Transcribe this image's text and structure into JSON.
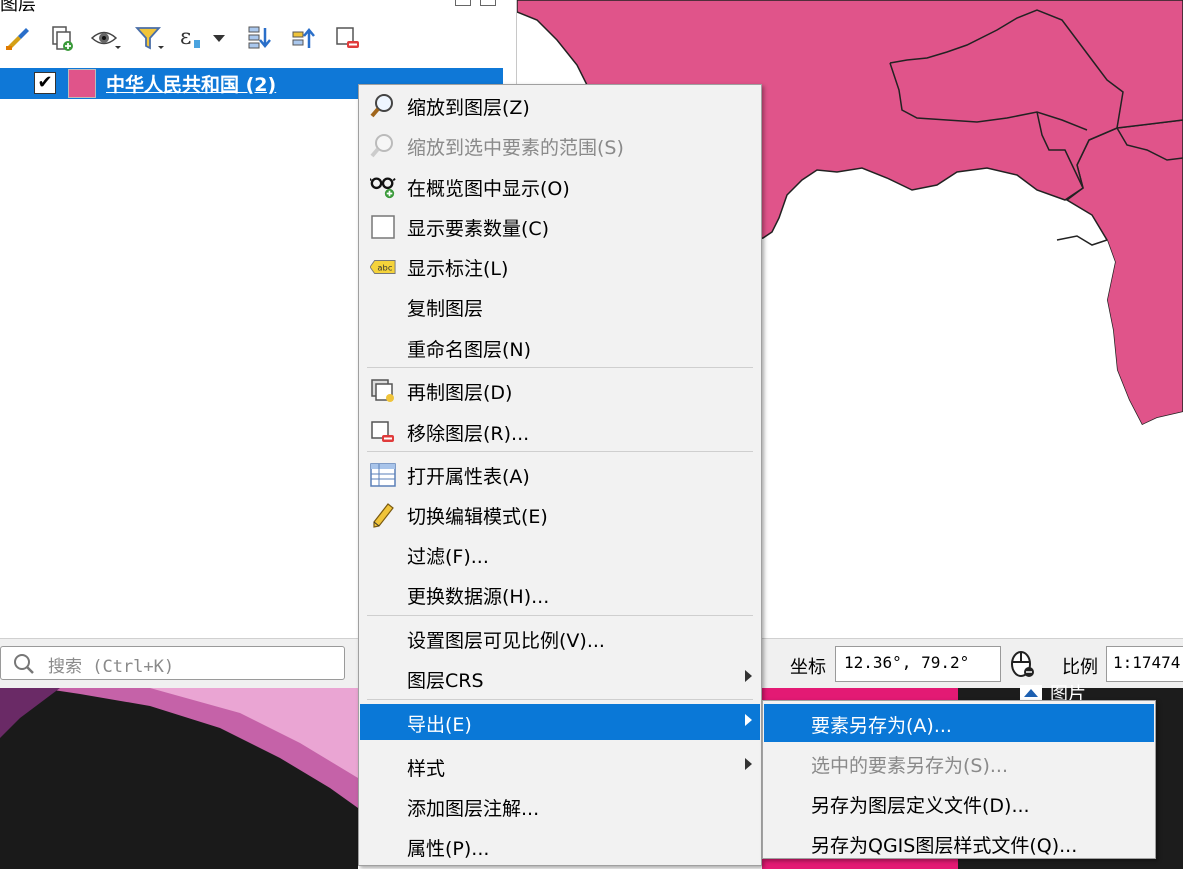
{
  "panel": {
    "title": "图层",
    "layer": {
      "checked": true,
      "check_mark": "✔",
      "name": "中华人民共和国 (2)",
      "color": "#e0548a"
    }
  },
  "toolbar": {
    "icons": [
      "style-brush-icon",
      "add-group-icon",
      "visibility-eye-icon",
      "filter-icon",
      "expression-icon",
      "expand-all-icon",
      "collapse-all-icon",
      "remove-layer-icon"
    ]
  },
  "status": {
    "search_placeholder": "搜索 (Ctrl+K)",
    "coord_label": "坐标",
    "coord_value": "12.36°, 79.2°",
    "scale_label": "比例",
    "scale_value": "1:17474"
  },
  "right_panel": {
    "title": "图片"
  },
  "menu": {
    "items": [
      {
        "label": "缩放到图层(Z)",
        "icon": "zoom-icon",
        "enabled": true
      },
      {
        "label": "缩放到选中要素的范围(S)",
        "icon": "zoom-icon",
        "enabled": false
      },
      {
        "label": "在概览图中显示(O)",
        "icon": "glasses-icon",
        "enabled": true
      },
      {
        "label": "显示要素数量(C)",
        "icon": "checkbox-icon",
        "enabled": true
      },
      {
        "label": "显示标注(L)",
        "icon": "label-abc-icon",
        "enabled": true
      },
      {
        "label": "复制图层",
        "enabled": true
      },
      {
        "label": "重命名图层(N)",
        "enabled": true
      },
      {
        "label": "再制图层(D)",
        "icon": "duplicate-layer-icon",
        "enabled": true
      },
      {
        "label": "移除图层(R)...",
        "icon": "remove-layer-icon",
        "enabled": true
      },
      {
        "label": "打开属性表(A)",
        "icon": "table-icon",
        "enabled": true
      },
      {
        "label": "切换编辑模式(E)",
        "icon": "pencil-icon",
        "enabled": true
      },
      {
        "label": "过滤(F)...",
        "enabled": true
      },
      {
        "label": "更换数据源(H)...",
        "enabled": true
      },
      {
        "label": "设置图层可见比例(V)...",
        "enabled": true
      },
      {
        "label": "图层CRS",
        "enabled": true,
        "submenu": true
      },
      {
        "label": "导出(E)",
        "enabled": true,
        "submenu": true,
        "active": true
      },
      {
        "label": "样式",
        "enabled": true,
        "submenu": true
      },
      {
        "label": "添加图层注解...",
        "enabled": true
      },
      {
        "label": "属性(P)...",
        "enabled": true
      }
    ]
  },
  "submenu": {
    "items": [
      {
        "label": "要素另存为(A)...",
        "enabled": true,
        "active": true
      },
      {
        "label": "选中的要素另存为(S)...",
        "enabled": false
      },
      {
        "label": "另存为图层定义文件(D)...",
        "enabled": true
      },
      {
        "label": "另存为QGIS图层样式文件(Q)...",
        "enabled": true
      }
    ]
  },
  "colors": {
    "map_fill": "#e0548a",
    "highlight": "#0a78d7",
    "menu_bg": "#f2f2f2"
  }
}
